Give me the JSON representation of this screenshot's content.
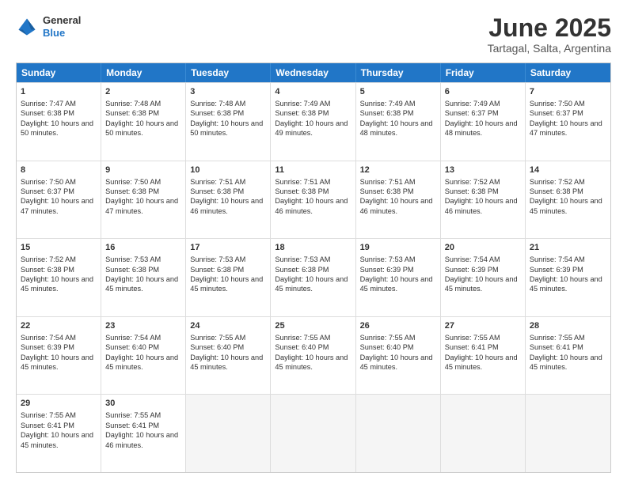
{
  "header": {
    "logo_general": "General",
    "logo_blue": "Blue",
    "main_title": "June 2025",
    "subtitle": "Tartagal, Salta, Argentina"
  },
  "calendar": {
    "days": [
      "Sunday",
      "Monday",
      "Tuesday",
      "Wednesday",
      "Thursday",
      "Friday",
      "Saturday"
    ],
    "rows": [
      [
        {
          "day": "",
          "empty": true
        },
        {
          "day": "2",
          "sr": "Sunrise: 7:48 AM",
          "ss": "Sunset: 6:38 PM",
          "dl": "Daylight: 10 hours and 50 minutes."
        },
        {
          "day": "3",
          "sr": "Sunrise: 7:48 AM",
          "ss": "Sunset: 6:38 PM",
          "dl": "Daylight: 10 hours and 50 minutes."
        },
        {
          "day": "4",
          "sr": "Sunrise: 7:49 AM",
          "ss": "Sunset: 6:38 PM",
          "dl": "Daylight: 10 hours and 49 minutes."
        },
        {
          "day": "5",
          "sr": "Sunrise: 7:49 AM",
          "ss": "Sunset: 6:38 PM",
          "dl": "Daylight: 10 hours and 48 minutes."
        },
        {
          "day": "6",
          "sr": "Sunrise: 7:49 AM",
          "ss": "Sunset: 6:37 PM",
          "dl": "Daylight: 10 hours and 48 minutes."
        },
        {
          "day": "7",
          "sr": "Sunrise: 7:50 AM",
          "ss": "Sunset: 6:37 PM",
          "dl": "Daylight: 10 hours and 47 minutes."
        }
      ],
      [
        {
          "day": "1",
          "sr": "Sunrise: 7:47 AM",
          "ss": "Sunset: 6:38 PM",
          "dl": "Daylight: 10 hours and 50 minutes."
        },
        {
          "day": "9",
          "sr": "Sunrise: 7:50 AM",
          "ss": "Sunset: 6:38 PM",
          "dl": "Daylight: 10 hours and 47 minutes."
        },
        {
          "day": "10",
          "sr": "Sunrise: 7:51 AM",
          "ss": "Sunset: 6:38 PM",
          "dl": "Daylight: 10 hours and 46 minutes."
        },
        {
          "day": "11",
          "sr": "Sunrise: 7:51 AM",
          "ss": "Sunset: 6:38 PM",
          "dl": "Daylight: 10 hours and 46 minutes."
        },
        {
          "day": "12",
          "sr": "Sunrise: 7:51 AM",
          "ss": "Sunset: 6:38 PM",
          "dl": "Daylight: 10 hours and 46 minutes."
        },
        {
          "day": "13",
          "sr": "Sunrise: 7:52 AM",
          "ss": "Sunset: 6:38 PM",
          "dl": "Daylight: 10 hours and 46 minutes."
        },
        {
          "day": "14",
          "sr": "Sunrise: 7:52 AM",
          "ss": "Sunset: 6:38 PM",
          "dl": "Daylight: 10 hours and 45 minutes."
        }
      ],
      [
        {
          "day": "8",
          "sr": "Sunrise: 7:50 AM",
          "ss": "Sunset: 6:37 PM",
          "dl": "Daylight: 10 hours and 47 minutes."
        },
        {
          "day": "16",
          "sr": "Sunrise: 7:53 AM",
          "ss": "Sunset: 6:38 PM",
          "dl": "Daylight: 10 hours and 45 minutes."
        },
        {
          "day": "17",
          "sr": "Sunrise: 7:53 AM",
          "ss": "Sunset: 6:38 PM",
          "dl": "Daylight: 10 hours and 45 minutes."
        },
        {
          "day": "18",
          "sr": "Sunrise: 7:53 AM",
          "ss": "Sunset: 6:38 PM",
          "dl": "Daylight: 10 hours and 45 minutes."
        },
        {
          "day": "19",
          "sr": "Sunrise: 7:53 AM",
          "ss": "Sunset: 6:39 PM",
          "dl": "Daylight: 10 hours and 45 minutes."
        },
        {
          "day": "20",
          "sr": "Sunrise: 7:54 AM",
          "ss": "Sunset: 6:39 PM",
          "dl": "Daylight: 10 hours and 45 minutes."
        },
        {
          "day": "21",
          "sr": "Sunrise: 7:54 AM",
          "ss": "Sunset: 6:39 PM",
          "dl": "Daylight: 10 hours and 45 minutes."
        }
      ],
      [
        {
          "day": "15",
          "sr": "Sunrise: 7:52 AM",
          "ss": "Sunset: 6:38 PM",
          "dl": "Daylight: 10 hours and 45 minutes."
        },
        {
          "day": "23",
          "sr": "Sunrise: 7:54 AM",
          "ss": "Sunset: 6:40 PM",
          "dl": "Daylight: 10 hours and 45 minutes."
        },
        {
          "day": "24",
          "sr": "Sunrise: 7:55 AM",
          "ss": "Sunset: 6:40 PM",
          "dl": "Daylight: 10 hours and 45 minutes."
        },
        {
          "day": "25",
          "sr": "Sunrise: 7:55 AM",
          "ss": "Sunset: 6:40 PM",
          "dl": "Daylight: 10 hours and 45 minutes."
        },
        {
          "day": "26",
          "sr": "Sunrise: 7:55 AM",
          "ss": "Sunset: 6:40 PM",
          "dl": "Daylight: 10 hours and 45 minutes."
        },
        {
          "day": "27",
          "sr": "Sunrise: 7:55 AM",
          "ss": "Sunset: 6:41 PM",
          "dl": "Daylight: 10 hours and 45 minutes."
        },
        {
          "day": "28",
          "sr": "Sunrise: 7:55 AM",
          "ss": "Sunset: 6:41 PM",
          "dl": "Daylight: 10 hours and 45 minutes."
        }
      ],
      [
        {
          "day": "22",
          "sr": "Sunrise: 7:54 AM",
          "ss": "Sunset: 6:39 PM",
          "dl": "Daylight: 10 hours and 45 minutes."
        },
        {
          "day": "30",
          "sr": "Sunrise: 7:55 AM",
          "ss": "Sunset: 6:41 PM",
          "dl": "Daylight: 10 hours and 46 minutes."
        },
        {
          "day": "",
          "empty": true
        },
        {
          "day": "",
          "empty": true
        },
        {
          "day": "",
          "empty": true
        },
        {
          "day": "",
          "empty": true
        },
        {
          "day": "",
          "empty": true
        }
      ],
      [
        {
          "day": "29",
          "sr": "Sunrise: 7:55 AM",
          "ss": "Sunset: 6:41 PM",
          "dl": "Daylight: 10 hours and 45 minutes."
        },
        {
          "day": "",
          "empty": true
        },
        {
          "day": "",
          "empty": true
        },
        {
          "day": "",
          "empty": true
        },
        {
          "day": "",
          "empty": true
        },
        {
          "day": "",
          "empty": true
        },
        {
          "day": "",
          "empty": true
        }
      ]
    ]
  }
}
